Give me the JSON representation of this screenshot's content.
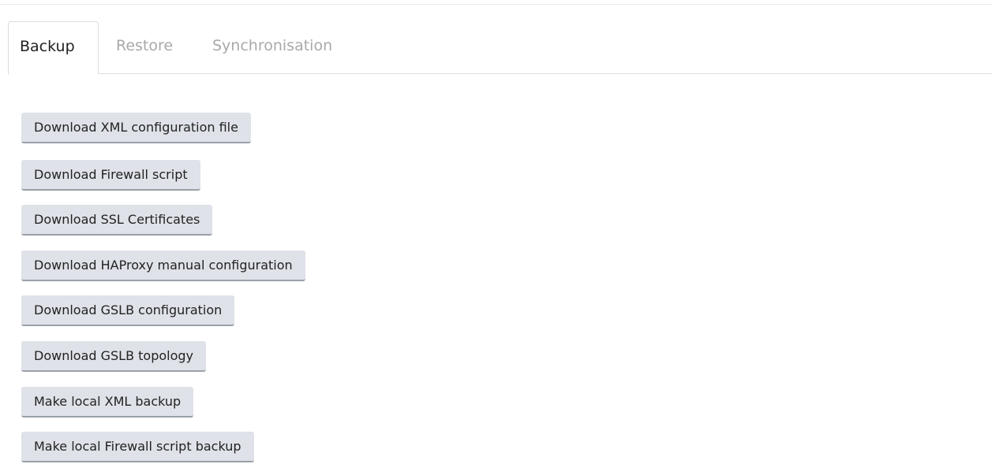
{
  "tabs": [
    {
      "label": "Backup",
      "active": true
    },
    {
      "label": "Restore",
      "active": false
    },
    {
      "label": "Synchronisation",
      "active": false
    }
  ],
  "buttons": [
    {
      "label": "Download XML configuration file"
    },
    {
      "label": "Download Firewall script"
    },
    {
      "label": "Download SSL Certificates"
    },
    {
      "label": "Download HAProxy manual configuration"
    },
    {
      "label": "Download GSLB configuration"
    },
    {
      "label": "Download GSLB topology"
    },
    {
      "label": "Make local XML backup"
    },
    {
      "label": "Make local Firewall script backup"
    }
  ],
  "colors": {
    "button_bg": "#dfe2e8",
    "button_border": "#9aa0a8",
    "tab_active_text": "#222222",
    "tab_inactive_text": "#a9a9a9"
  }
}
